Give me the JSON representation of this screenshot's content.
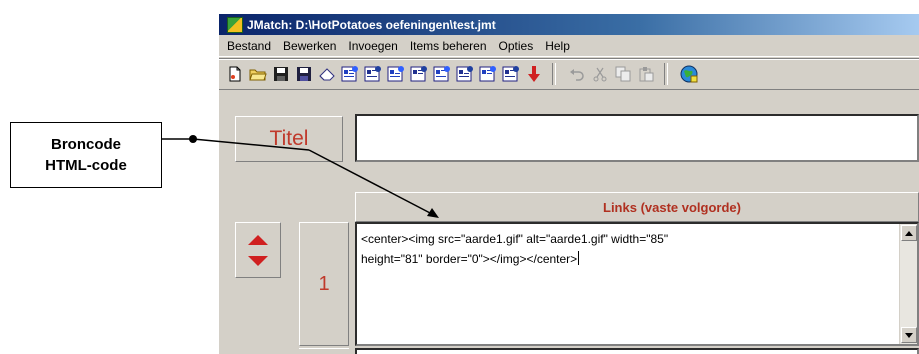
{
  "callout": {
    "line1": "Broncode",
    "line2": "HTML-code"
  },
  "window": {
    "title": "JMatch: D:\\HotPotatoes oefeningen\\test.jmt",
    "menu": [
      "Bestand",
      "Bewerken",
      "Invoegen",
      "Items beheren",
      "Opties",
      "Help"
    ],
    "toolbar_icons": [
      "new-file-icon",
      "open-folder-icon",
      "save-icon",
      "save-as-icon",
      "eraser-icon",
      "export-web-page-1-icon",
      "export-web-page-2-icon",
      "export-web-page-3-icon",
      "export-web-page-4-icon",
      "export-web-page-5-icon",
      "export-web-page-6-icon",
      "export-web-page-7-icon",
      "export-web-page-8-icon",
      "down-arrow-icon"
    ],
    "toolbar_icons_disabled": [
      "undo-icon",
      "cut-icon",
      "copy-icon",
      "paste-icon"
    ],
    "toolbar_last": "help-globe-icon"
  },
  "content": {
    "title_label": "Titel",
    "title_value": "",
    "links_header": "Links (vaste volgorde)",
    "row_number": "1",
    "row_text": "<center><img src=\"aarde1.gif\" alt=\"aarde1.gif\" width=\"85\"\nheight=\"81\" border=\"0\"></img></center>"
  },
  "colors": {
    "accent_red": "#c0392b",
    "title_bar": "#0a246a",
    "face": "#d4d0c8"
  }
}
